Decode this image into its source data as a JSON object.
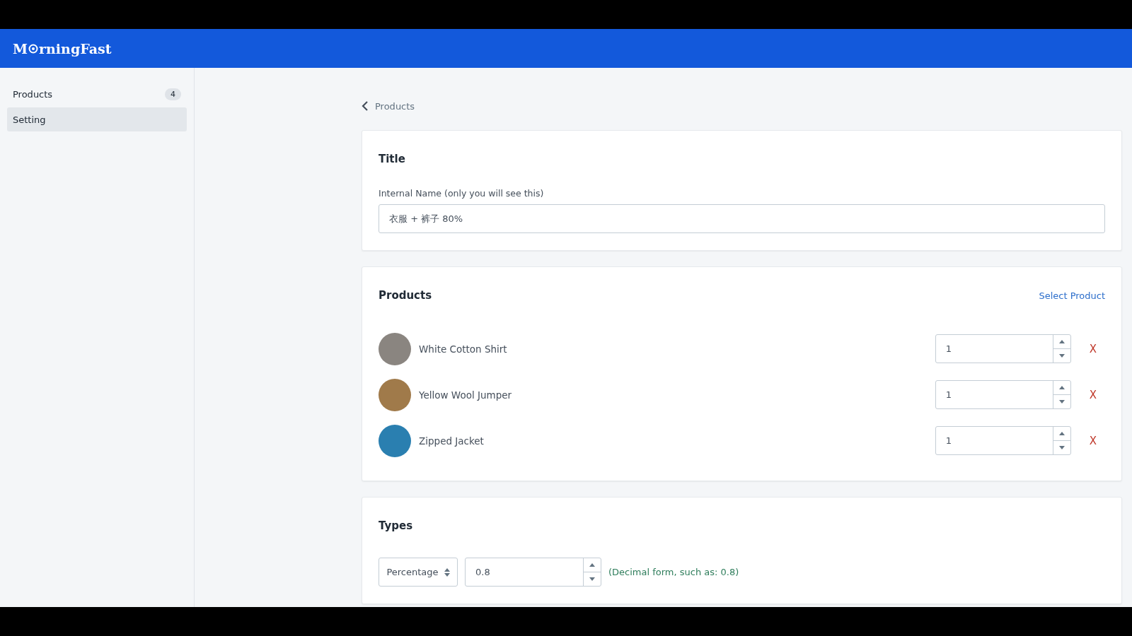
{
  "header": {
    "logo_before": "M",
    "logo_after": "rningFast"
  },
  "sidebar": {
    "items": [
      {
        "label": "Products",
        "badge": "4",
        "selected": false
      },
      {
        "label": "Setting",
        "selected": true
      }
    ]
  },
  "back_link": {
    "label": "Products"
  },
  "title_card": {
    "heading": "Title",
    "field_label": "Internal Name (only you will see this)",
    "value": "衣服 + 裤子 80%"
  },
  "products_card": {
    "heading": "Products",
    "action": "Select Product",
    "items": [
      {
        "name": "White Cotton Shirt",
        "quantity": "1",
        "remove": "X"
      },
      {
        "name": "Yellow Wool Jumper",
        "quantity": "1",
        "remove": "X"
      },
      {
        "name": "Zipped Jacket",
        "quantity": "1",
        "remove": "X"
      }
    ]
  },
  "types_card": {
    "heading": "Types",
    "select": "Percentage",
    "value": "0.8",
    "hint": "(Decimal form, such as: 0.8)"
  }
}
